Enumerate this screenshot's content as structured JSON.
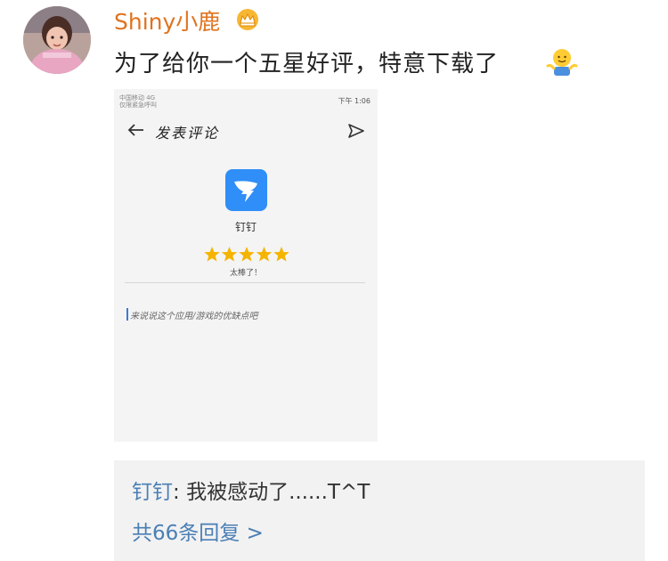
{
  "post": {
    "username": "Shiny小鹿",
    "badge_icon": "crown-icon",
    "comment_text": "为了给你一个五星好评，特意下载了",
    "emoji_icon": "shrug-emoji-icon",
    "accent_color": "#e0731e"
  },
  "screenshot": {
    "status_bar_left": "中国移动 4G\n仅限紧急呼叫",
    "status_bar_right": "下午 1:06",
    "title": "发表评论",
    "app_name": "钉钉",
    "rating": 5,
    "rating_max": 5,
    "rating_text": "太棒了！",
    "input_placeholder": "来说说这个应用/游戏的优缺点吧"
  },
  "reply": {
    "author": "钉钉",
    "separator": ": ",
    "text": "我被感动了......T^T",
    "count_text": "共66条回复 >",
    "link_color": "#4a7fb5"
  }
}
